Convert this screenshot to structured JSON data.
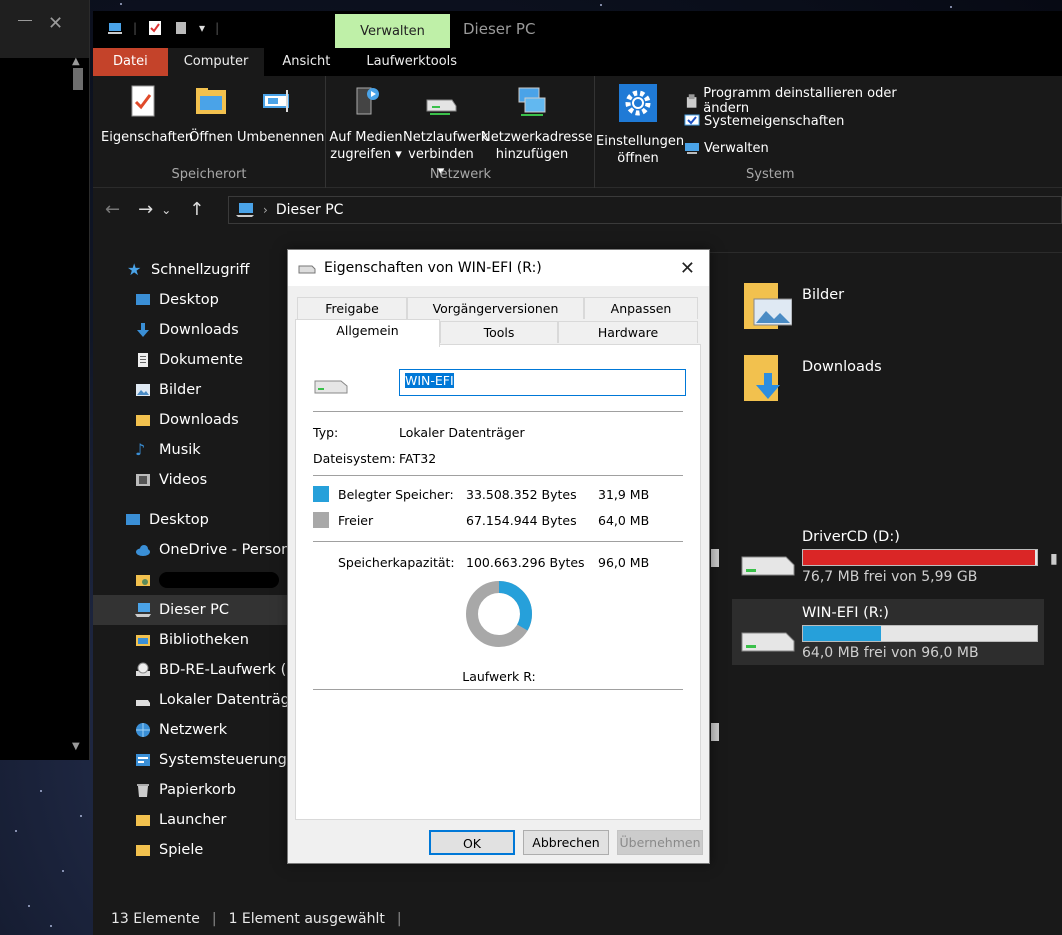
{
  "explorer": {
    "window_title": "Dieser PC",
    "contextual_tab": "Verwalten",
    "ribbon_tabs": [
      "Datei",
      "Computer",
      "Ansicht",
      "Laufwerktools"
    ],
    "ribbon": {
      "speicherort": {
        "label": "Speicherort",
        "eigenschaften": "Eigenschaften",
        "oeffnen": "Öffnen",
        "umbenennen": "Umbenennen"
      },
      "netzwerk": {
        "label": "Netzwerk",
        "medien_l1": "Auf Medien",
        "medien_l2": "zugreifen ▾",
        "netzlaufwerk_l1": "Netzlaufwerk",
        "netzlaufwerk_l2": "verbinden ▾",
        "netzwerkadresse_l1": "Netzwerkadresse",
        "netzwerkadresse_l2": "hinzufügen"
      },
      "system": {
        "label": "System",
        "einstellungen_l1": "Einstellungen",
        "einstellungen_l2": "öffnen",
        "programm": "Programm deinstallieren oder ändern",
        "systemeigenschaften": "Systemeigenschaften",
        "verwalten": "Verwalten"
      }
    },
    "address": "Dieser PC",
    "nav": {
      "schnellzugriff": "Schnellzugriff",
      "desktop": "Desktop",
      "downloads": "Downloads",
      "dokumente": "Dokumente",
      "bilder": "Bilder",
      "downloads2": "Downloads",
      "musik": "Musik",
      "videos": "Videos",
      "desktop_root": "Desktop",
      "onedrive": "OneDrive - Persona",
      "dieser_pc": "Dieser PC",
      "bibliotheken": "Bibliotheken",
      "bdre": "BD-RE-Laufwerk (G",
      "lokal": "Lokaler Datenträge",
      "netzwerk": "Netzwerk",
      "systemsteuerung": "Systemsteuerung",
      "papierkorb": "Papierkorb",
      "launcher": "Launcher",
      "spiele": "Spiele"
    },
    "folders": {
      "bilder": "Bilder",
      "downloads": "Downloads"
    },
    "drives": {
      "driver": {
        "name": "DriverCD (D:)",
        "free": "76,7 MB frei von 5,99 GB",
        "used_fraction": 0.99,
        "color": "#da2626"
      },
      "winefi": {
        "name": "WIN-EFI (R:)",
        "free": "64,0 MB frei von 96,0 MB",
        "used_fraction": 0.333,
        "color": "#26a0da"
      }
    },
    "status": {
      "count": "13 Elemente",
      "selection": "1 Element ausgewählt"
    }
  },
  "dialog": {
    "title": "Eigenschaften von WIN-EFI (R:)",
    "tabs": {
      "freigabe": "Freigabe",
      "vorgaenger": "Vorgängerversionen",
      "anpassen": "Anpassen",
      "allgemein": "Allgemein",
      "tools": "Tools",
      "hardware": "Hardware"
    },
    "name_value": "WIN-EFI",
    "typ_label": "Typ:",
    "typ_value": "Lokaler Datenträger",
    "fs_label": "Dateisystem:",
    "fs_value": "FAT32",
    "used_label": "Belegter Speicher:",
    "used_bytes": "33.508.352 Bytes",
    "used_mb": "31,9 MB",
    "free_label": "Freier",
    "free_bytes": "67.154.944 Bytes",
    "free_mb": "64,0 MB",
    "cap_label": "Speicherkapazität:",
    "cap_bytes": "100.663.296 Bytes",
    "cap_mb": "96,0 MB",
    "used_fraction": 0.333,
    "used_color": "#26a0da",
    "free_color": "#a8a8a8",
    "drive_label": "Laufwerk R:",
    "buttons": {
      "ok": "OK",
      "cancel": "Abbrechen",
      "apply": "Übernehmen"
    }
  }
}
